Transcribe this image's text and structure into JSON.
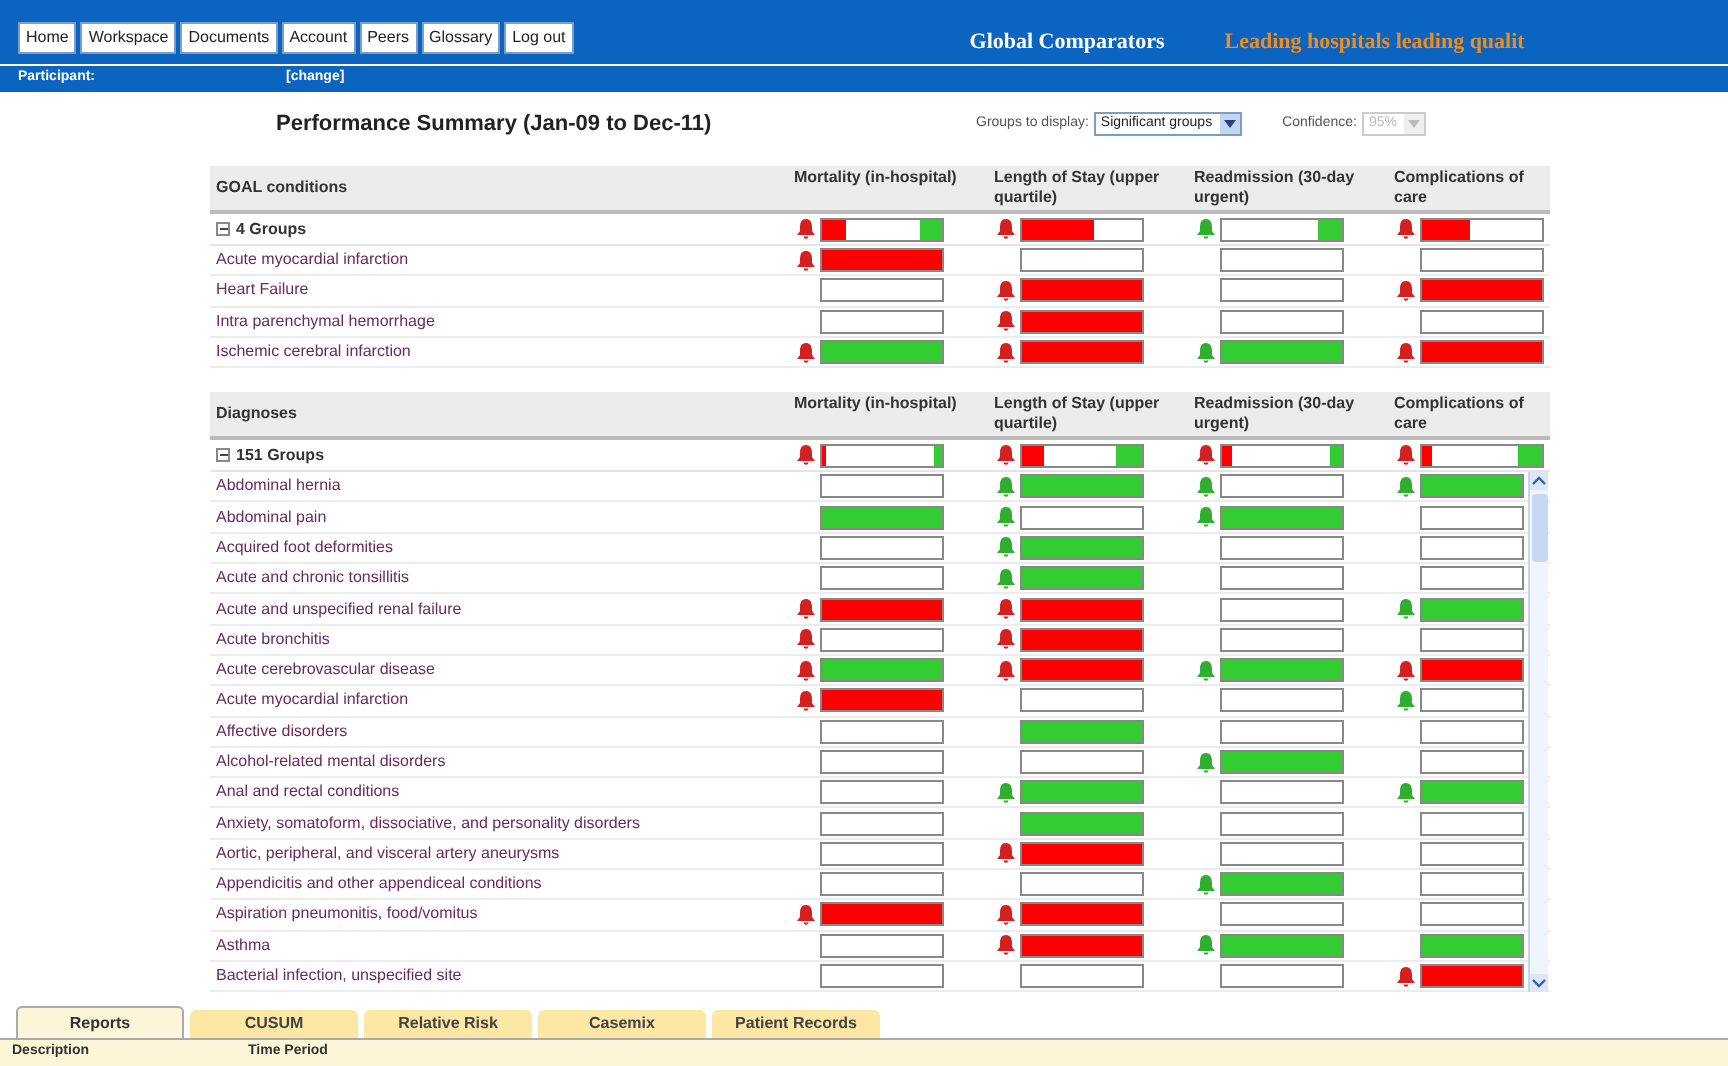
{
  "nav": [
    "Home",
    "Workspace",
    "Documents",
    "Account",
    "Peers",
    "Glossary",
    "Log out"
  ],
  "brand": "Global Comparators",
  "tagline": "Leading hospitals leading qualit",
  "participant": {
    "label": "Participant:",
    "link": "[change]"
  },
  "title": "Performance Summary (Jan-09 to Dec-11)",
  "filters": [
    {
      "label": "Groups to display:",
      "value": "Significant groups",
      "disabled": false
    },
    {
      "label": "Confidence:",
      "value": "95%",
      "disabled": true
    }
  ],
  "sections": [
    {
      "title": "GOAL conditions",
      "columns": [
        "Mortality (in-hospital)",
        "Length of Stay (upper quartile)",
        "Readmission (30-day urgent)",
        "Complications of care"
      ],
      "group": {
        "label": "4 Groups",
        "expanded": true,
        "cells": [
          {
            "kind": "split",
            "bell": {
              "color": "#d42020"
            },
            "parts": [
              {
                "kind": "red",
                "level": 0.2
              },
              {
                "kind": "green",
                "level": 0.18
              }
            ]
          },
          {
            "kind": "split",
            "bell": {
              "color": "#d42020"
            },
            "parts": [
              {
                "kind": "red",
                "level": 0.6
              }
            ]
          },
          {
            "kind": "split",
            "bell": {
              "color": "#2fae2f"
            },
            "parts": [
              {
                "kind": "green",
                "level": 0.2
              }
            ]
          },
          {
            "kind": "split",
            "bell": {
              "color": "#d42020"
            },
            "parts": [
              {
                "kind": "red",
                "level": 0.4
              }
            ]
          }
        ]
      },
      "rows": [
        {
          "label": "Acute myocardial infarction",
          "cells": [
            {
              "kind": "red",
              "bell": {
                "color": "#d42020"
              }
            },
            {
              "kind": "empty"
            },
            {
              "kind": "empty"
            },
            {
              "kind": "empty"
            }
          ]
        },
        {
          "label": "Heart Failure",
          "cells": [
            {
              "kind": "empty"
            },
            {
              "kind": "red",
              "bell": {
                "color": "#d42020"
              }
            },
            {
              "kind": "empty"
            },
            {
              "kind": "red",
              "bell": {
                "color": "#d42020"
              }
            }
          ]
        },
        {
          "label": "Intra parenchymal hemorrhage",
          "cells": [
            {
              "kind": "empty"
            },
            {
              "kind": "red",
              "bell": {
                "color": "#d42020"
              }
            },
            {
              "kind": "empty"
            },
            {
              "kind": "empty"
            }
          ]
        },
        {
          "label": "Ischemic cerebral infarction",
          "cells": [
            {
              "kind": "green",
              "bell": {
                "color": "#d42020"
              }
            },
            {
              "kind": "red",
              "bell": {
                "color": "#d42020"
              }
            },
            {
              "kind": "green",
              "bell": {
                "color": "#2fae2f"
              }
            },
            {
              "kind": "red",
              "bell": {
                "color": "#d42020"
              }
            }
          ]
        }
      ]
    },
    {
      "title": "Diagnoses",
      "columns": [
        "Mortality (in-hospital)",
        "Length of Stay (upper quartile)",
        "Readmission (30-day urgent)",
        "Complications of care"
      ],
      "group": {
        "label": "151 Groups",
        "expanded": true,
        "cells": [
          {
            "kind": "split",
            "bell": {
              "color": "#d42020"
            },
            "parts": [
              {
                "kind": "red",
                "level": 0.04
              },
              {
                "kind": "green",
                "level": 0.06
              }
            ]
          },
          {
            "kind": "split",
            "bell": {
              "color": "#d42020"
            },
            "parts": [
              {
                "kind": "red",
                "level": 0.18
              },
              {
                "kind": "green",
                "level": 0.22
              }
            ]
          },
          {
            "kind": "split",
            "bell": {
              "color": "#d42020"
            },
            "parts": [
              {
                "kind": "red",
                "level": 0.08
              },
              {
                "kind": "green",
                "level": 0.1
              }
            ]
          },
          {
            "kind": "split",
            "bell": {
              "color": "#d42020"
            },
            "parts": [
              {
                "kind": "red",
                "level": 0.08
              },
              {
                "kind": "green",
                "level": 0.2
              }
            ]
          }
        ]
      },
      "rows": [
        {
          "label": "Abdominal hernia",
          "cells": [
            {
              "kind": "empty"
            },
            {
              "kind": "green",
              "bell": {
                "color": "#2fae2f"
              }
            },
            {
              "kind": "empty",
              "bell": {
                "color": "#2fae2f"
              }
            },
            {
              "kind": "green",
              "bell": {
                "color": "#2fae2f"
              }
            }
          ]
        },
        {
          "label": "Abdominal pain",
          "cells": [
            {
              "kind": "green"
            },
            {
              "kind": "empty",
              "bell": {
                "color": "#2fae2f"
              }
            },
            {
              "kind": "green",
              "bell": {
                "color": "#2fae2f"
              }
            },
            {
              "kind": "empty"
            }
          ]
        },
        {
          "label": "Acquired foot deformities",
          "cells": [
            {
              "kind": "empty"
            },
            {
              "kind": "green",
              "bell": {
                "color": "#2fae2f"
              }
            },
            {
              "kind": "empty"
            },
            {
              "kind": "empty"
            }
          ]
        },
        {
          "label": "Acute and chronic tonsillitis",
          "cells": [
            {
              "kind": "empty"
            },
            {
              "kind": "green",
              "bell": {
                "color": "#2fae2f"
              }
            },
            {
              "kind": "empty"
            },
            {
              "kind": "empty"
            }
          ]
        },
        {
          "label": "Acute and unspecified renal failure",
          "cells": [
            {
              "kind": "red",
              "bell": {
                "color": "#d42020"
              }
            },
            {
              "kind": "red",
              "bell": {
                "color": "#d42020"
              }
            },
            {
              "kind": "empty"
            },
            {
              "kind": "green",
              "bell": {
                "color": "#2fae2f"
              }
            }
          ]
        },
        {
          "label": "Acute bronchitis",
          "cells": [
            {
              "kind": "empty",
              "bell": {
                "color": "#d42020"
              }
            },
            {
              "kind": "red",
              "bell": {
                "color": "#d42020"
              }
            },
            {
              "kind": "empty"
            },
            {
              "kind": "empty"
            }
          ]
        },
        {
          "label": "Acute cerebrovascular disease",
          "cells": [
            {
              "kind": "green",
              "bell": {
                "color": "#d42020"
              }
            },
            {
              "kind": "red",
              "bell": {
                "color": "#d42020"
              }
            },
            {
              "kind": "green",
              "bell": {
                "color": "#2fae2f"
              }
            },
            {
              "kind": "red",
              "bell": {
                "color": "#d42020"
              }
            }
          ]
        },
        {
          "label": "Acute myocardial infarction",
          "cells": [
            {
              "kind": "red",
              "bell": {
                "color": "#d42020"
              }
            },
            {
              "kind": "empty"
            },
            {
              "kind": "empty"
            },
            {
              "kind": "empty",
              "bell": {
                "color": "#2fae2f"
              }
            }
          ]
        },
        {
          "label": "Affective disorders",
          "cells": [
            {
              "kind": "empty"
            },
            {
              "kind": "green"
            },
            {
              "kind": "empty"
            },
            {
              "kind": "empty"
            }
          ]
        },
        {
          "label": "Alcohol-related mental disorders",
          "cells": [
            {
              "kind": "empty"
            },
            {
              "kind": "empty"
            },
            {
              "kind": "green",
              "bell": {
                "color": "#2fae2f"
              }
            },
            {
              "kind": "empty"
            }
          ]
        },
        {
          "label": "Anal and rectal conditions",
          "cells": [
            {
              "kind": "empty"
            },
            {
              "kind": "green",
              "bell": {
                "color": "#2fae2f"
              }
            },
            {
              "kind": "empty"
            },
            {
              "kind": "green",
              "bell": {
                "color": "#2fae2f"
              }
            }
          ]
        },
        {
          "label": "Anxiety, somatoform, dissociative, and personality disorders",
          "cells": [
            {
              "kind": "empty"
            },
            {
              "kind": "green"
            },
            {
              "kind": "empty"
            },
            {
              "kind": "empty"
            }
          ]
        },
        {
          "label": "Aortic, peripheral, and visceral artery aneurysms",
          "cells": [
            {
              "kind": "empty"
            },
            {
              "kind": "red",
              "bell": {
                "color": "#d42020"
              }
            },
            {
              "kind": "empty"
            },
            {
              "kind": "empty"
            }
          ]
        },
        {
          "label": "Appendicitis and other appendiceal conditions",
          "cells": [
            {
              "kind": "empty"
            },
            {
              "kind": "empty"
            },
            {
              "kind": "green",
              "bell": {
                "color": "#2fae2f"
              }
            },
            {
              "kind": "empty"
            }
          ]
        },
        {
          "label": "Aspiration pneumonitis, food/vomitus",
          "cells": [
            {
              "kind": "red",
              "bell": {
                "color": "#d42020"
              }
            },
            {
              "kind": "red",
              "bell": {
                "color": "#d42020"
              }
            },
            {
              "kind": "empty"
            },
            {
              "kind": "empty"
            }
          ]
        },
        {
          "label": "Asthma",
          "cells": [
            {
              "kind": "empty"
            },
            {
              "kind": "red",
              "bell": {
                "color": "#d42020"
              }
            },
            {
              "kind": "green",
              "bell": {
                "color": "#2fae2f"
              }
            },
            {
              "kind": "green"
            }
          ]
        },
        {
          "label": "Bacterial infection, unspecified site",
          "cells": [
            {
              "kind": "empty"
            },
            {
              "kind": "empty"
            },
            {
              "kind": "empty"
            },
            {
              "kind": "red",
              "bell": {
                "color": "#d42020"
              }
            }
          ]
        }
      ]
    }
  ],
  "tabs": [
    {
      "label": "Reports",
      "selected": true
    },
    {
      "label": "CUSUM",
      "selected": false
    },
    {
      "label": "Relative Risk",
      "selected": false
    },
    {
      "label": "Casemix",
      "selected": false
    },
    {
      "label": "Patient Records",
      "selected": false
    }
  ],
  "footer": [
    "Description",
    "Time Period"
  ]
}
